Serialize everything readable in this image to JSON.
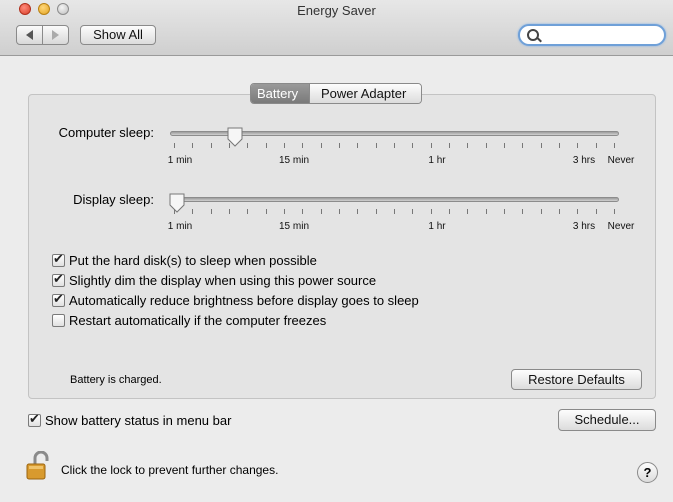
{
  "window": {
    "title": "Energy Saver"
  },
  "toolbar": {
    "back_icon": "back-arrow-icon",
    "forward_icon": "forward-arrow-icon",
    "show_all_label": "Show All",
    "search_placeholder": "",
    "search_value": ""
  },
  "tabs": [
    {
      "label": "Battery",
      "selected": true
    },
    {
      "label": "Power Adapter",
      "selected": false
    }
  ],
  "computer_sleep": {
    "label": "Computer sleep:",
    "ticks": [
      "1 min",
      "15 min",
      "1 hr",
      "3 hrs",
      "Never"
    ]
  },
  "display_sleep": {
    "label": "Display sleep:",
    "ticks": [
      "1 min",
      "15 min",
      "1 hr",
      "3 hrs",
      "Never"
    ]
  },
  "options": [
    {
      "label": "Put the hard disk(s) to sleep when possible",
      "checked": true
    },
    {
      "label": "Slightly dim the display when using this power source",
      "checked": true
    },
    {
      "label": "Automatically reduce brightness before display goes to sleep",
      "checked": true
    },
    {
      "label": "Restart automatically if the computer freezes",
      "checked": false
    }
  ],
  "battery_status": "Battery is charged.",
  "restore_defaults_label": "Restore Defaults",
  "show_battery_status": {
    "label": "Show battery status in menu bar",
    "checked": true
  },
  "schedule_label": "Schedule...",
  "lock": {
    "icon": "unlocked-padlock-icon",
    "text": "Click the lock to prevent further changes."
  },
  "help_label": "?",
  "colors": {
    "search_focus": "#6fa0d8",
    "selected_tab": "#8a8a8a"
  }
}
